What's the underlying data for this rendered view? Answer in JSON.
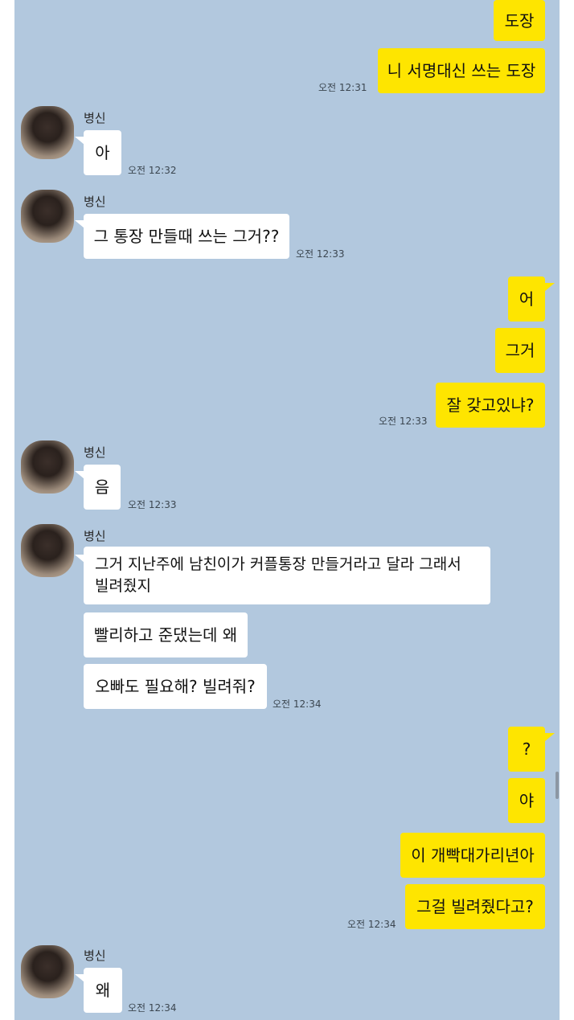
{
  "colors": {
    "chat_bg": "#b2c8de",
    "my_bubble": "#fee500",
    "other_bubble": "#ffffff"
  },
  "contact": {
    "name": "병신",
    "avatar_icon": "profile-photo"
  },
  "messages": [
    {
      "text": "도장",
      "from": "me"
    },
    {
      "text": "니 서명대신 쓰는 도장",
      "from": "me",
      "time": "오전 12:31"
    },
    {
      "text": "아",
      "from": "other",
      "time": "오전 12:32"
    },
    {
      "text": "그 통장 만들때 쓰는 그거??",
      "from": "other",
      "time": "오전 12:33"
    },
    {
      "text": "어",
      "from": "me"
    },
    {
      "text": "그거",
      "from": "me"
    },
    {
      "text": "잘 갖고있냐?",
      "from": "me",
      "time": "오전 12:33"
    },
    {
      "text": "음",
      "from": "other",
      "time": "오전 12:33"
    },
    {
      "text": "그거 지난주에 남친이가 커플통장 만들거라고 달라 그래서 빌려줬지",
      "from": "other"
    },
    {
      "text": "빨리하고 준댔는데 왜",
      "from": "other"
    },
    {
      "text": "오빠도 필요해? 빌려줘?",
      "from": "other",
      "time": "오전 12:34"
    },
    {
      "text": "?",
      "from": "me"
    },
    {
      "text": "야",
      "from": "me"
    },
    {
      "text": "이 개빡대가리년아",
      "from": "me"
    },
    {
      "text": "그걸 빌려줬다고?",
      "from": "me",
      "time": "오전 12:34"
    },
    {
      "text": "왜",
      "from": "other",
      "time": "오전 12:34"
    }
  ]
}
